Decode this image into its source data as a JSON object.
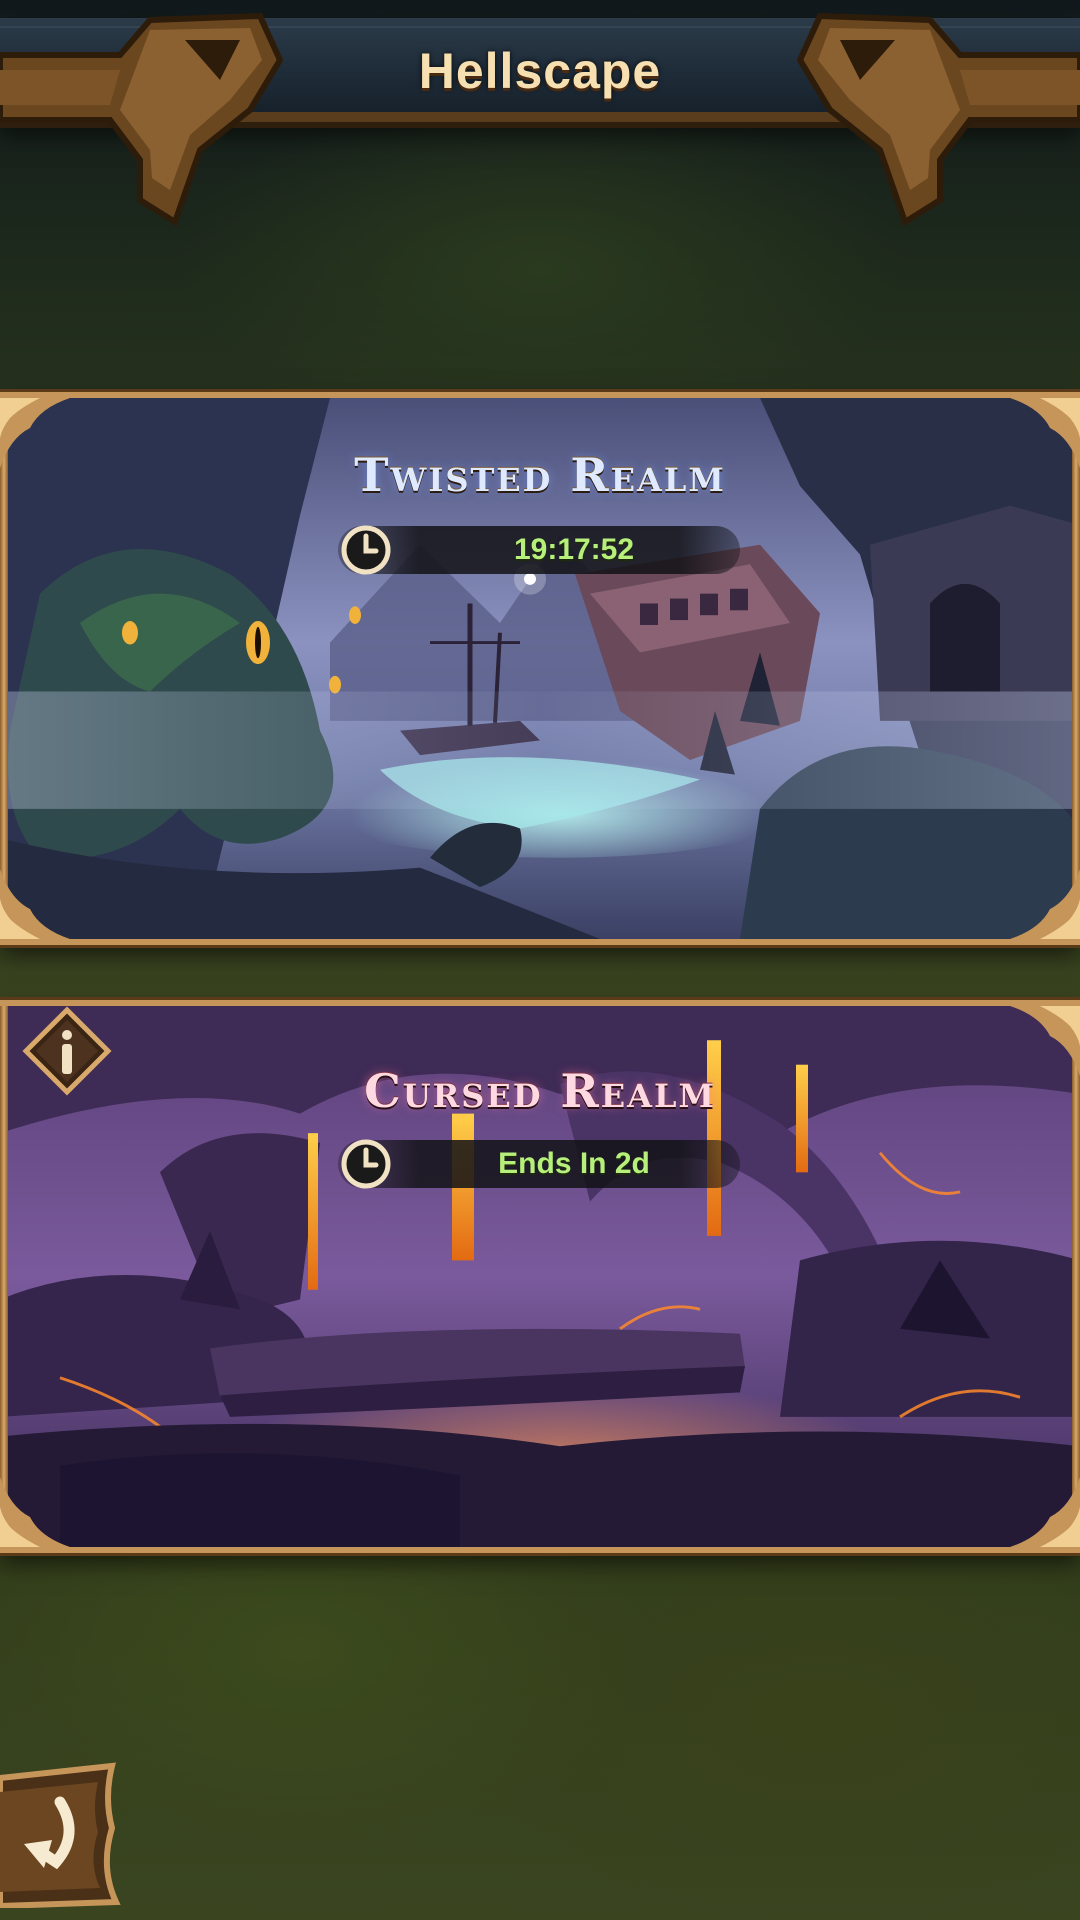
{
  "header": {
    "title": "Hellscape"
  },
  "realms": [
    {
      "title": "Twisted Realm",
      "timer": "19:17:52",
      "timer_color": "#b6f07a",
      "icon": "clock-icon"
    },
    {
      "title": "Cursed Realm",
      "timer": "Ends In 2d",
      "timer_color": "#b6f07a",
      "icon": "clock-icon",
      "info_icon": "info-icon"
    }
  ],
  "footer": {
    "back_icon": "back-arrow-icon"
  },
  "colors": {
    "frame_gold": "#c6955a",
    "title_cream": "#f6dfb0",
    "twisted_accent": "#dfe9ff",
    "cursed_accent": "#ffd9e2"
  }
}
